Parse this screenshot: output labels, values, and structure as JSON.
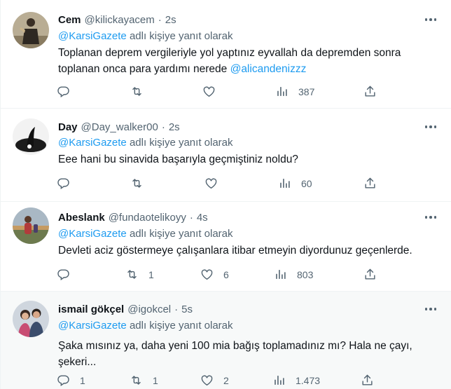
{
  "reply_prefix_suffix": "adlı kişiye yanıt olarak",
  "tweets": [
    {
      "name": "Cem",
      "handle": "@kilickayacem",
      "time": "2s",
      "reply_to": "@KarsiGazete",
      "text_before": "Toplanan deprem vergileriyle yol yaptınız eyvallah da depremden sonra toplanan onca para yardımı nerede ",
      "text_mention": "@alicandenizzz",
      "replies": "",
      "retweets": "",
      "likes": "",
      "views": "387"
    },
    {
      "name": "Day",
      "handle": "@Day_walker00",
      "time": "2s",
      "reply_to": "@KarsiGazete",
      "text_before": "Eee hani bu sinavida başarıyla geçmiştiniz noldu?",
      "text_mention": "",
      "replies": "",
      "retweets": "",
      "likes": "",
      "views": "60"
    },
    {
      "name": "Abeslank",
      "handle": "@fundaotelikoyy",
      "time": "4s",
      "reply_to": "@KarsiGazete",
      "text_before": "Devleti aciz göstermeye çalışanlara itibar etmeyin diyordunuz geçenlerde.",
      "text_mention": "",
      "replies": "",
      "retweets": "1",
      "likes": "6",
      "views": "803"
    },
    {
      "name": "ismail gökçel",
      "handle": "@igokcel",
      "time": "5s",
      "reply_to": "@KarsiGazete",
      "text_before": "Şaka mısınız ya, daha yeni 100 mia bağış toplamadınız mı? Hala ne çayı, şekeri...",
      "text_mention": "",
      "replies": "1",
      "retweets": "1",
      "likes": "2",
      "views": "1.473"
    }
  ],
  "icons": {
    "reply": "reply-icon",
    "retweet": "retweet-icon",
    "like": "heart-icon",
    "views": "views-icon",
    "share": "share-icon",
    "more": "more-icon"
  },
  "colors": {
    "accent": "#1d9bf0",
    "secondary_text": "#536471",
    "divider": "#eff3f4",
    "hover_bg": "#f7f9f9"
  }
}
